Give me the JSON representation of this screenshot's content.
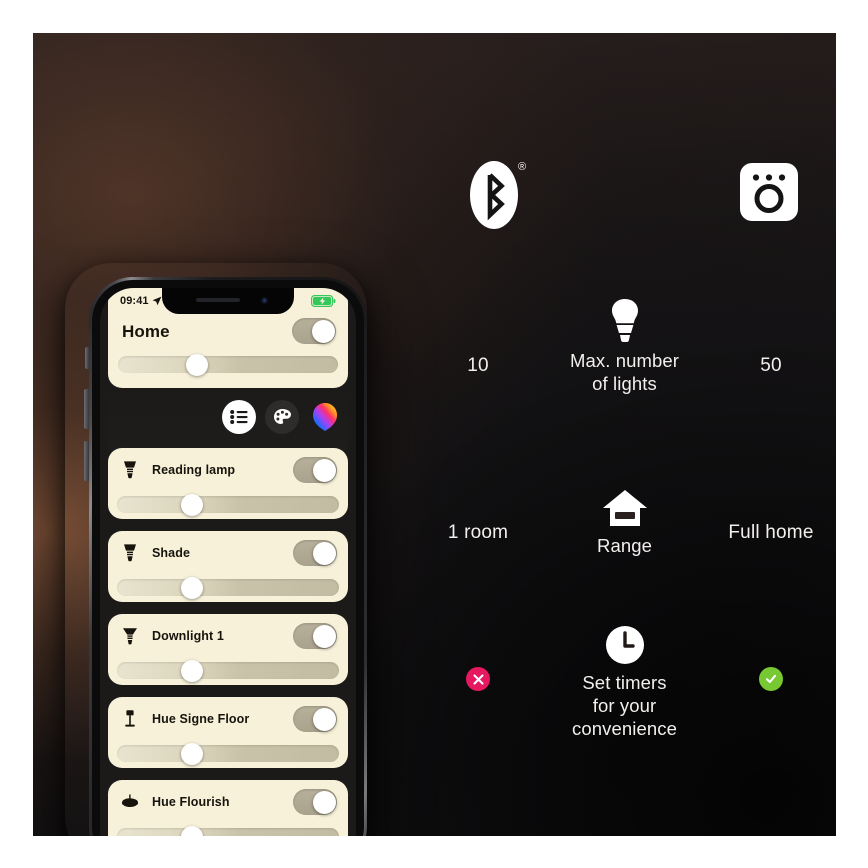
{
  "comparison": {
    "rows": [
      {
        "id": "max-lights",
        "icon": "bulb-icon",
        "left_value": "10",
        "caption": "Max. number\nof lights",
        "caption_line1": "Max. number",
        "caption_line2": "of lights",
        "right_value": "50"
      },
      {
        "id": "range",
        "icon": "house-icon",
        "left_value": "1 room",
        "caption_line1": "Range",
        "caption_line2": "",
        "right_value": "Full home"
      },
      {
        "id": "timers",
        "icon": "clock-icon",
        "left_value": "",
        "left_badge": "cross-badge",
        "caption_line1": "Set timers",
        "caption_line2": "for your",
        "caption_line3": "convenience",
        "right_value": "",
        "right_badge": "check-badge"
      }
    ],
    "logos": {
      "left": "bluetooth-icon",
      "left_mark": "®",
      "right": "hue-bridge-icon"
    }
  },
  "phone": {
    "status_bar": {
      "time": "09:41",
      "location_icon": "location-arrow-icon",
      "battery_icon": "battery-charging-icon"
    },
    "header": {
      "title": "Home",
      "toggle": "on",
      "brightness_percent": 32
    },
    "tabs": [
      {
        "id": "list",
        "icon": "list-icon",
        "state": "active"
      },
      {
        "id": "scenes",
        "icon": "palette-icon",
        "state": "inactive"
      },
      {
        "id": "colors",
        "icon": "color-bulb-icon",
        "state": "inactive"
      }
    ],
    "lights": [
      {
        "name": "Reading lamp",
        "icon": "spot-bulb-icon",
        "toggle": "on",
        "brightness_percent": 30
      },
      {
        "name": "Shade",
        "icon": "spot-bulb-icon",
        "toggle": "on",
        "brightness_percent": 30
      },
      {
        "name": "Downlight 1",
        "icon": "downlight-icon",
        "toggle": "on",
        "brightness_percent": 30
      },
      {
        "name": "Hue Signe Floor",
        "icon": "floor-lamp-icon",
        "toggle": "on",
        "brightness_percent": 30
      },
      {
        "name": "Hue Flourish",
        "icon": "pendant-icon",
        "toggle": "on",
        "brightness_percent": 30
      }
    ]
  },
  "colors": {
    "cream": "#f7f1d9",
    "cross_badge": "#e6185f",
    "check_badge": "#77c832",
    "text_light": "#f2efec",
    "battery_green": "#34c759"
  }
}
